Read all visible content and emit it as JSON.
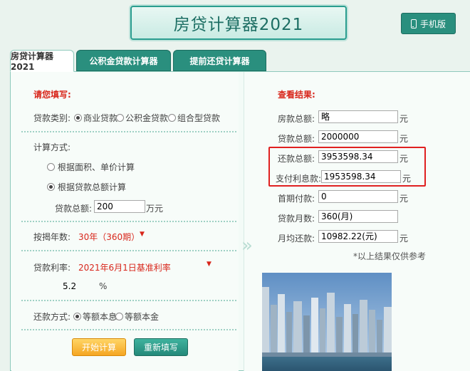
{
  "header": {
    "title": "房贷计算器2021",
    "mobile_label": "手机版"
  },
  "tabs": [
    {
      "label": "房贷计算器2021",
      "active": true
    },
    {
      "label": "公积金贷款计算器",
      "active": false
    },
    {
      "label": "提前还贷计算器",
      "active": false
    }
  ],
  "form": {
    "heading": "请您填写:",
    "loan_type_label": "贷款类别:",
    "loan_types": [
      "商业贷款",
      "公积金贷款",
      "组合型贷款"
    ],
    "loan_type_selected": "商业贷款",
    "calc_method_label": "计算方式:",
    "calc_methods": [
      "根据面积、单价计算",
      "根据贷款总额计算"
    ],
    "calc_method_selected": "根据贷款总额计算",
    "loan_amount_label": "贷款总额:",
    "loan_amount_value": "200",
    "loan_amount_unit": "万元",
    "years_label": "按揭年数:",
    "years_value": "30年（360期）",
    "rate_label": "贷款利率:",
    "rate_value": "2021年6月1日基准利率",
    "rate_number": "5.2",
    "rate_unit": "%",
    "repay_label": "还款方式:",
    "repay_methods": [
      "等额本息",
      "等额本金"
    ],
    "repay_selected": "等额本息",
    "start_button": "开始计算",
    "reset_button": "重新填写"
  },
  "results": {
    "heading": "查看结果:",
    "unit": "元",
    "rows": [
      {
        "label": "房款总额:",
        "value": "略",
        "unit": "元"
      },
      {
        "label": "贷款总额:",
        "value": "2000000",
        "unit": "元"
      },
      {
        "label": "还款总额:",
        "value": "3953598.34",
        "unit": "元"
      },
      {
        "label": "支付利息款:",
        "value": "1953598.34",
        "unit": "元"
      },
      {
        "label": "首期付款:",
        "value": "0",
        "unit": "元"
      },
      {
        "label": "贷款月数:",
        "value": "360(月)",
        "unit": ""
      },
      {
        "label": "月均还款:",
        "value": "10982.22(元)",
        "unit": "元"
      }
    ],
    "note": "*以上结果仅供参考"
  },
  "colors": {
    "accent": "#2a8f7e",
    "highlight": "#e02020",
    "red_text": "#d8261b"
  }
}
